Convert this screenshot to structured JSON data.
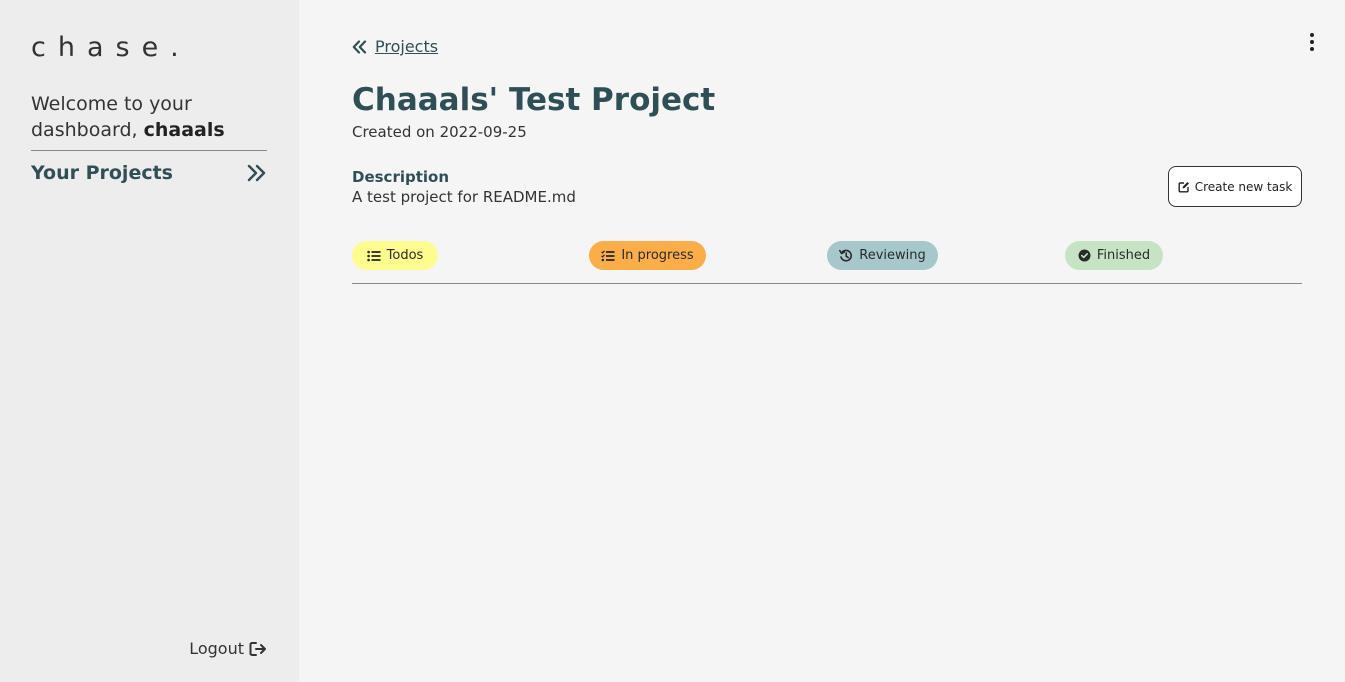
{
  "app": {
    "logo": "chase."
  },
  "sidebar": {
    "welcome_prefix": "Welcome to your dashboard, ",
    "username": "chaaals",
    "projects_label": "Your Projects",
    "logout_label": "Logout"
  },
  "header": {
    "back_label": "Projects"
  },
  "project": {
    "title": "Chaaals' Test Project",
    "created": "Created on 2022-09-25",
    "description_heading": "Description",
    "description": "A test project for README.md",
    "create_task_label": "Create new task"
  },
  "statuses": [
    {
      "label": "Todos",
      "color": "#fcfc8f",
      "icon": "list-icon"
    },
    {
      "label": "In progress",
      "color": "#fbae47",
      "icon": "checklist-icon"
    },
    {
      "label": "Reviewing",
      "color": "#a6c8ca",
      "icon": "history-icon"
    },
    {
      "label": "Finished",
      "color": "#c6e4c4",
      "icon": "check-circle-icon"
    }
  ],
  "colors": {
    "accent": "#2f4f57",
    "sidebar_bg": "#ededed",
    "main_bg": "#f5f5f5"
  }
}
